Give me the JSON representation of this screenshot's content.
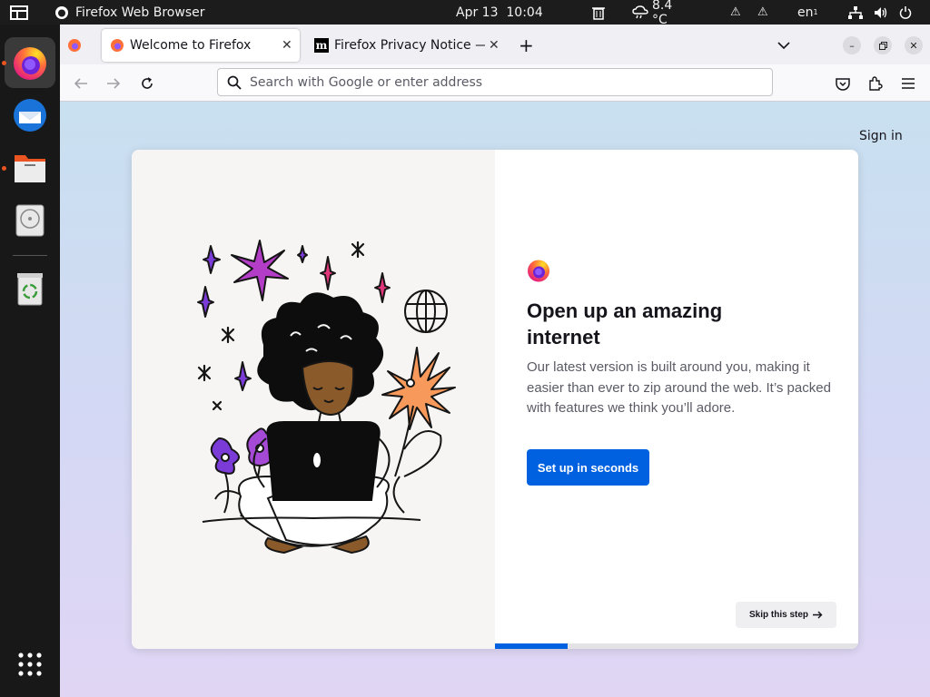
{
  "topbar": {
    "app_name": "Firefox Web Browser",
    "clock": "Apr 13  10:04",
    "weather": "8.4 °C",
    "keyboard": "en",
    "keyboard_sub": "1"
  },
  "browser": {
    "tabs": [
      {
        "title": "Welcome to Firefox",
        "selected": true
      },
      {
        "title": "Firefox Privacy Notice — ",
        "selected": false
      }
    ],
    "url_placeholder": "Search with Google or enter address"
  },
  "page": {
    "sign_in": "Sign in",
    "heading": "Open up an amazing internet",
    "subtext": "Our latest version is built around you, making it easier than ever to zip around the web. It’s packed with features we think you’ll adore.",
    "primary_button": "Set up in seconds",
    "skip_button": "Skip this step",
    "progress": 0.2
  },
  "colors": {
    "accent": "#0061e0",
    "ubuntu_orange": "#e95420"
  },
  "icons": [
    "workspaces-icon",
    "firefox-icon",
    "thunderbird-icon",
    "files-icon",
    "disk-icon",
    "trash-icon",
    "app-grid-icon",
    "search-icon",
    "pocket-icon",
    "extensions-icon",
    "menu-icon"
  ]
}
